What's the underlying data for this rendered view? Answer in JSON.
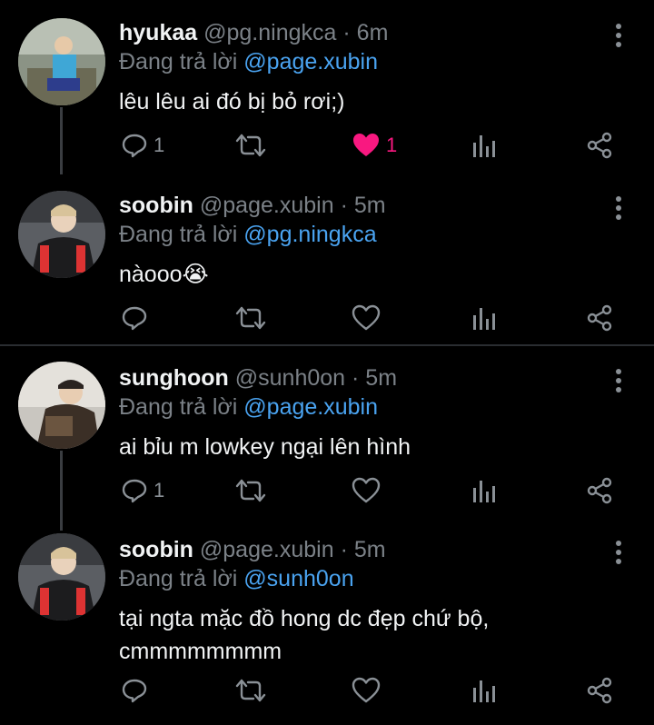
{
  "tweets": [
    {
      "name": "hyukaa",
      "handle": "@pg.ningkca",
      "time": "· 6m",
      "reply_prefix": "Đang trả lời",
      "reply_to": "@page.xubin",
      "text": "lêu lêu ai đó bị bỏ rơi;)",
      "reply_count": "1",
      "like_count": "1",
      "liked": true
    },
    {
      "name": "soobin",
      "handle": "@page.xubin",
      "time": "· 5m",
      "reply_prefix": "Đang trả lời",
      "reply_to": "@pg.ningkca",
      "text": "nàooo😭",
      "reply_count": "",
      "like_count": "",
      "liked": false
    },
    {
      "name": "sunghoon",
      "handle": "@sunh0on",
      "time": "· 5m",
      "reply_prefix": "Đang trả lời",
      "reply_to": "@page.xubin",
      "text": "ai bỉu m lowkey ngại lên hình",
      "reply_count": "1",
      "like_count": "",
      "liked": false
    },
    {
      "name": "soobin",
      "handle": "@page.xubin",
      "time": "· 5m",
      "reply_prefix": "Đang trả lời",
      "reply_to": "@sunh0on",
      "text": "tại ngta mặc đồ hong dc đẹp chứ bộ, cmmmmmmmm",
      "reply_count": "",
      "like_count": "",
      "liked": false
    }
  ],
  "colors": {
    "background": "#000000",
    "link": "#4aa3f0",
    "like": "#f91880",
    "muted": "#7b8187"
  },
  "icons": [
    "reply-icon",
    "retweet-icon",
    "like-icon",
    "analytics-icon",
    "share-icon",
    "more-icon"
  ]
}
